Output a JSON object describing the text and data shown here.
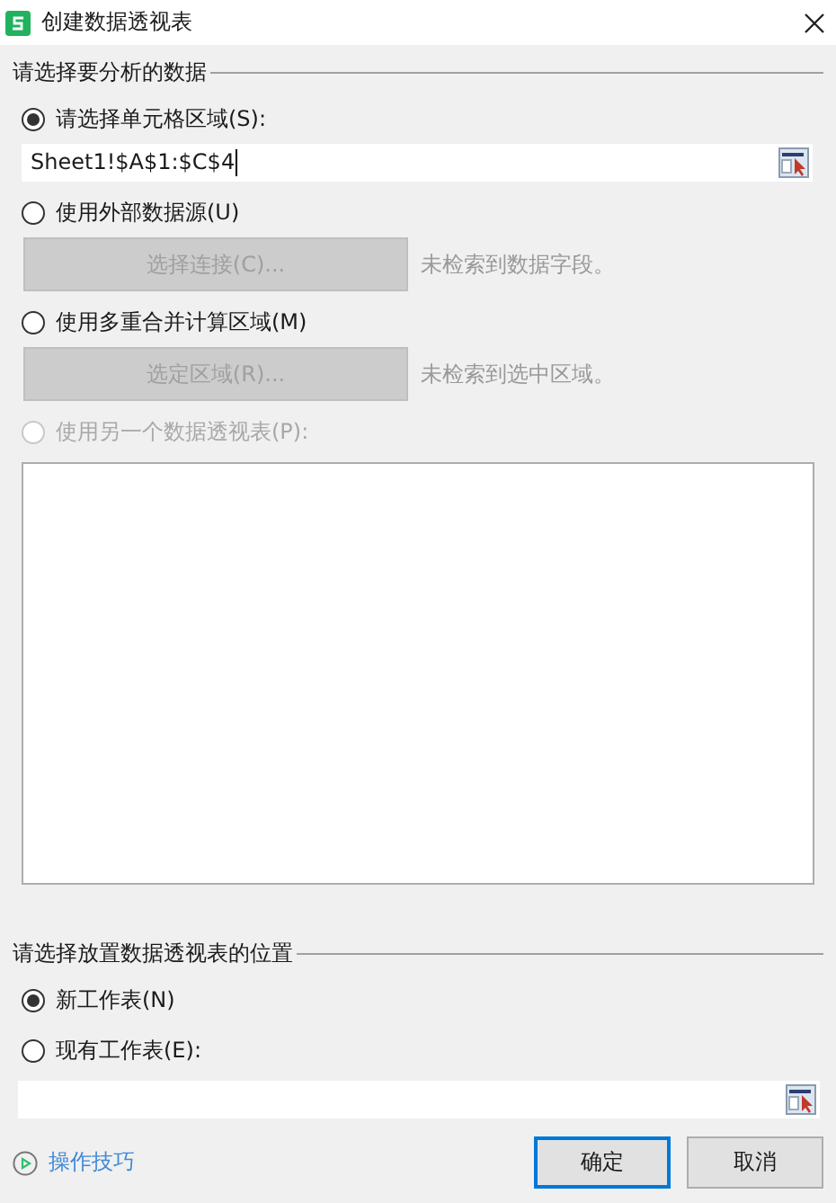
{
  "window": {
    "title": "创建数据透视表"
  },
  "source_section": {
    "title": "请选择要分析的数据",
    "options": [
      {
        "kind": "field",
        "label": "请选择单元格区域(S):",
        "selected": true,
        "disabled": false,
        "value": "Sheet1!$A$1:$C$4"
      },
      {
        "kind": "button",
        "label": "使用外部数据源(U)",
        "selected": false,
        "disabled": false,
        "button": "选择连接(C)...",
        "note": "未检索到数据字段。"
      },
      {
        "kind": "button",
        "label": "使用多重合并计算区域(M)",
        "selected": false,
        "disabled": false,
        "button": "选定区域(R)...",
        "note": "未检索到选中区域。"
      },
      {
        "kind": "list",
        "label": "使用另一个数据透视表(P):",
        "selected": false,
        "disabled": true
      }
    ]
  },
  "target_section": {
    "title": "请选择放置数据透视表的位置",
    "options": [
      {
        "label": "新工作表(N)",
        "selected": true,
        "disabled": false
      },
      {
        "label": "现有工作表(E):",
        "selected": false,
        "disabled": false
      }
    ]
  },
  "footer": {
    "tips_link": "操作技巧",
    "buttons": [
      {
        "label": "确定",
        "default": true
      },
      {
        "label": "取消",
        "default": false
      }
    ]
  }
}
